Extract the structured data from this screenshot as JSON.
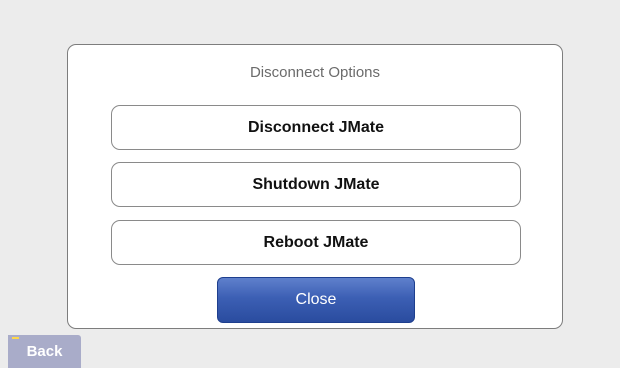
{
  "dialog": {
    "title": "Disconnect Options",
    "options": [
      {
        "label": "Disconnect JMate"
      },
      {
        "label": "Shutdown JMate"
      },
      {
        "label": "Reboot JMate"
      }
    ],
    "close_label": "Close"
  },
  "footer": {
    "back_label": "Back"
  },
  "colors": {
    "background": "#ececec",
    "close_button": "#3c5fb4",
    "back_button": "#a9acc9"
  }
}
